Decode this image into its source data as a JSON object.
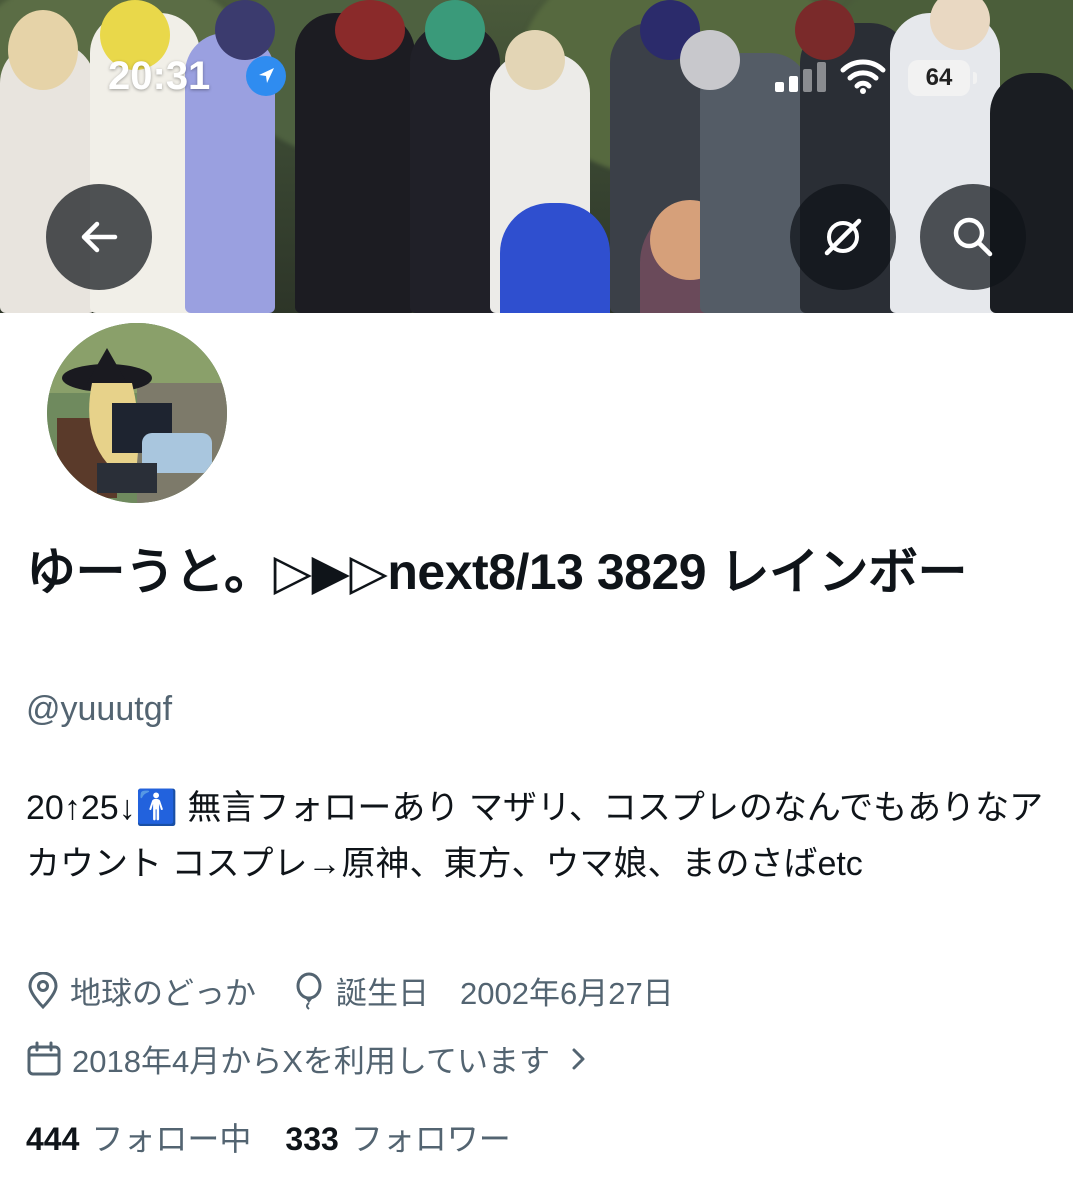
{
  "status_bar": {
    "time": "20:31",
    "battery": "64"
  },
  "banner": {
    "description_icon": "group-photo"
  },
  "nav": {
    "back_icon": "back-arrow-icon",
    "grok_icon": "grok-icon",
    "search_icon": "search-icon"
  },
  "profile": {
    "display_name": "ゆーうと。▷▶▷next8/13 3829 レインボー",
    "handle": "@yuuutgf",
    "bio": "20↑25↓🚹 無言フォローあり マザリ、コスプレのなんでもありなアカウント コスプレ→原神、東方、ウマ娘、まのさばetc",
    "location": "地球のどっか",
    "birthday": "誕生日　2002年6月27日",
    "joined": "2018年4月からXを利用しています"
  },
  "stats": {
    "following_count": "444",
    "following_label": "フォロー中",
    "followers_count": "333",
    "followers_label": "フォロワー"
  },
  "colors": {
    "text_primary": "#0f1419",
    "text_secondary": "#536471",
    "overlay_button": "#0f1419"
  }
}
